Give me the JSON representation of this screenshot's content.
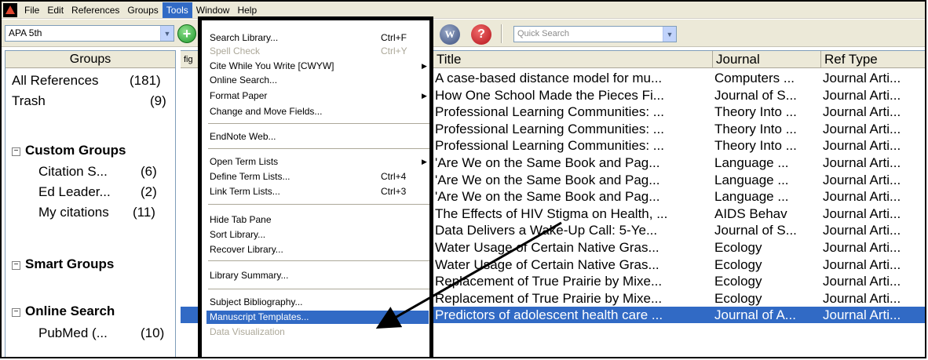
{
  "menubar": {
    "items": [
      "File",
      "Edit",
      "References",
      "Groups",
      "Tools",
      "Window",
      "Help"
    ],
    "active": "Tools"
  },
  "toolbar": {
    "style_value": "APA 5th",
    "search_placeholder": "Quick Search",
    "word_button_label": "W",
    "help_button_label": "?"
  },
  "groups": {
    "header": "Groups",
    "all_references": {
      "label": "All References",
      "count": "(181)"
    },
    "trash": {
      "label": "Trash",
      "count": "(9)"
    },
    "custom_groups": {
      "title": "Custom Groups",
      "items": [
        {
          "label": "Citation S...",
          "count": "(6)"
        },
        {
          "label": "Ed Leader...",
          "count": "(2)"
        },
        {
          "label": "My citations",
          "count": "(11)"
        }
      ]
    },
    "smart_groups": {
      "title": "Smart Groups"
    },
    "online_search": {
      "title": "Online Search",
      "items": [
        {
          "label": "PubMed (...",
          "count": "(10)"
        }
      ]
    }
  },
  "reference_list": {
    "columns": {
      "figure": "fig",
      "title": "Title",
      "journal": "Journal",
      "ref_type": "Ref Type"
    },
    "rows": [
      {
        "title": "A case-based distance model for mu...",
        "journal": "Computers ...",
        "ref_type": "Journal Arti..."
      },
      {
        "title": "How One School Made the Pieces Fi...",
        "journal": "Journal of S...",
        "ref_type": "Journal Arti..."
      },
      {
        "title": "Professional Learning Communities: ...",
        "journal": "Theory Into ...",
        "ref_type": "Journal Arti..."
      },
      {
        "title": "Professional Learning Communities: ...",
        "journal": "Theory Into ...",
        "ref_type": "Journal Arti..."
      },
      {
        "title": "Professional Learning Communities: ...",
        "journal": "Theory Into ...",
        "ref_type": "Journal Arti..."
      },
      {
        "title": "'Are We on the Same Book and Pag...",
        "journal": "Language ...",
        "ref_type": "Journal Arti..."
      },
      {
        "title": "'Are We on the Same Book and Pag...",
        "journal": "Language ...",
        "ref_type": "Journal Arti..."
      },
      {
        "title": "'Are We on the Same Book and Pag...",
        "journal": "Language ...",
        "ref_type": "Journal Arti..."
      },
      {
        "title": "The Effects of HIV Stigma on Health, ...",
        "journal": "AIDS Behav",
        "ref_type": "Journal Arti..."
      },
      {
        "title": "Data Delivers a Wake-Up Call: 5-Ye...",
        "journal": "Journal of S...",
        "ref_type": "Journal Arti..."
      },
      {
        "title": "Water Usage of Certain Native Gras...",
        "journal": "Ecology",
        "ref_type": "Journal Arti..."
      },
      {
        "title": "Water Usage of Certain Native Gras...",
        "journal": "Ecology",
        "ref_type": "Journal Arti..."
      },
      {
        "title": "Replacement of True Prairie by Mixe...",
        "journal": "Ecology",
        "ref_type": "Journal Arti..."
      },
      {
        "title": "Replacement of True Prairie by Mixe...",
        "journal": "Ecology",
        "ref_type": "Journal Arti..."
      },
      {
        "title": "Predictors of adolescent health care ...",
        "journal": "Journal of A...",
        "ref_type": "Journal Arti..."
      }
    ],
    "selected_row": 14
  },
  "tools_menu": {
    "items": [
      {
        "label": "Search Library...",
        "shortcut": "Ctrl+F"
      },
      {
        "label": "Spell Check",
        "shortcut": "Ctrl+Y",
        "disabled": true
      },
      {
        "label": "Cite While You Write [CWYW]",
        "submenu": true
      },
      {
        "label": "Online Search..."
      },
      {
        "label": "Format Paper",
        "submenu": true
      },
      {
        "label": "Change and Move Fields..."
      },
      {
        "label": "EndNote Web..."
      },
      {
        "label": "Open Term Lists",
        "submenu": true
      },
      {
        "label": "Define Term Lists...",
        "shortcut": "Ctrl+4"
      },
      {
        "label": "Link Term Lists...",
        "shortcut": "Ctrl+3"
      },
      {
        "label": "Hide Tab Pane"
      },
      {
        "label": "Sort Library..."
      },
      {
        "label": "Recover Library..."
      },
      {
        "label": "Library Summary..."
      },
      {
        "label": "Subject Bibliography..."
      },
      {
        "label": "Manuscript Templates...",
        "highlighted": true
      },
      {
        "label": "Data Visualization",
        "disabled": true
      }
    ]
  },
  "colors": {
    "selection": "#316ac5",
    "chrome": "#ece9d8",
    "disabled_text": "#aca899"
  }
}
